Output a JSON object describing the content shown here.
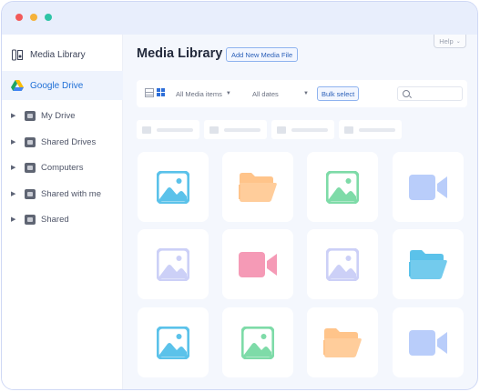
{
  "sidebar": {
    "media_library": "Media Library",
    "google_drive": "Google Drive",
    "items": [
      {
        "label": "My Drive"
      },
      {
        "label": "Shared Drives"
      },
      {
        "label": "Computers"
      },
      {
        "label": "Shared with me"
      },
      {
        "label": "Shared"
      }
    ]
  },
  "header": {
    "title": "Media Library",
    "add_new": "Add New Media File",
    "help": "Help"
  },
  "toolbar": {
    "media_filter": "All Media items",
    "date_filter": "All dates",
    "bulk_select": "Bulk select",
    "search_placeholder": ""
  },
  "grid": {
    "rows": [
      [
        "image-icon",
        "folder-icon",
        "image-icon",
        "video-icon"
      ],
      [
        "image-icon",
        "video-icon",
        "image-icon",
        "folder-icon"
      ],
      [
        "image-icon",
        "image-icon",
        "folder-icon",
        "video-icon"
      ]
    ],
    "colors": [
      [
        "#5bc2ea",
        "#ffc48a",
        "#7edba8",
        "#b9cdfa"
      ],
      [
        "#ccd0f7",
        "#f59ab6",
        "#ccd0f7",
        "#5bc2ea"
      ],
      [
        "#5bc2ea",
        "#7edba8",
        "#ffc48a",
        "#b9cdfa"
      ]
    ]
  },
  "colors": {
    "accent": "#2e6fd8",
    "window_border": "#cfd8f5",
    "background": "#f4f7fd"
  }
}
